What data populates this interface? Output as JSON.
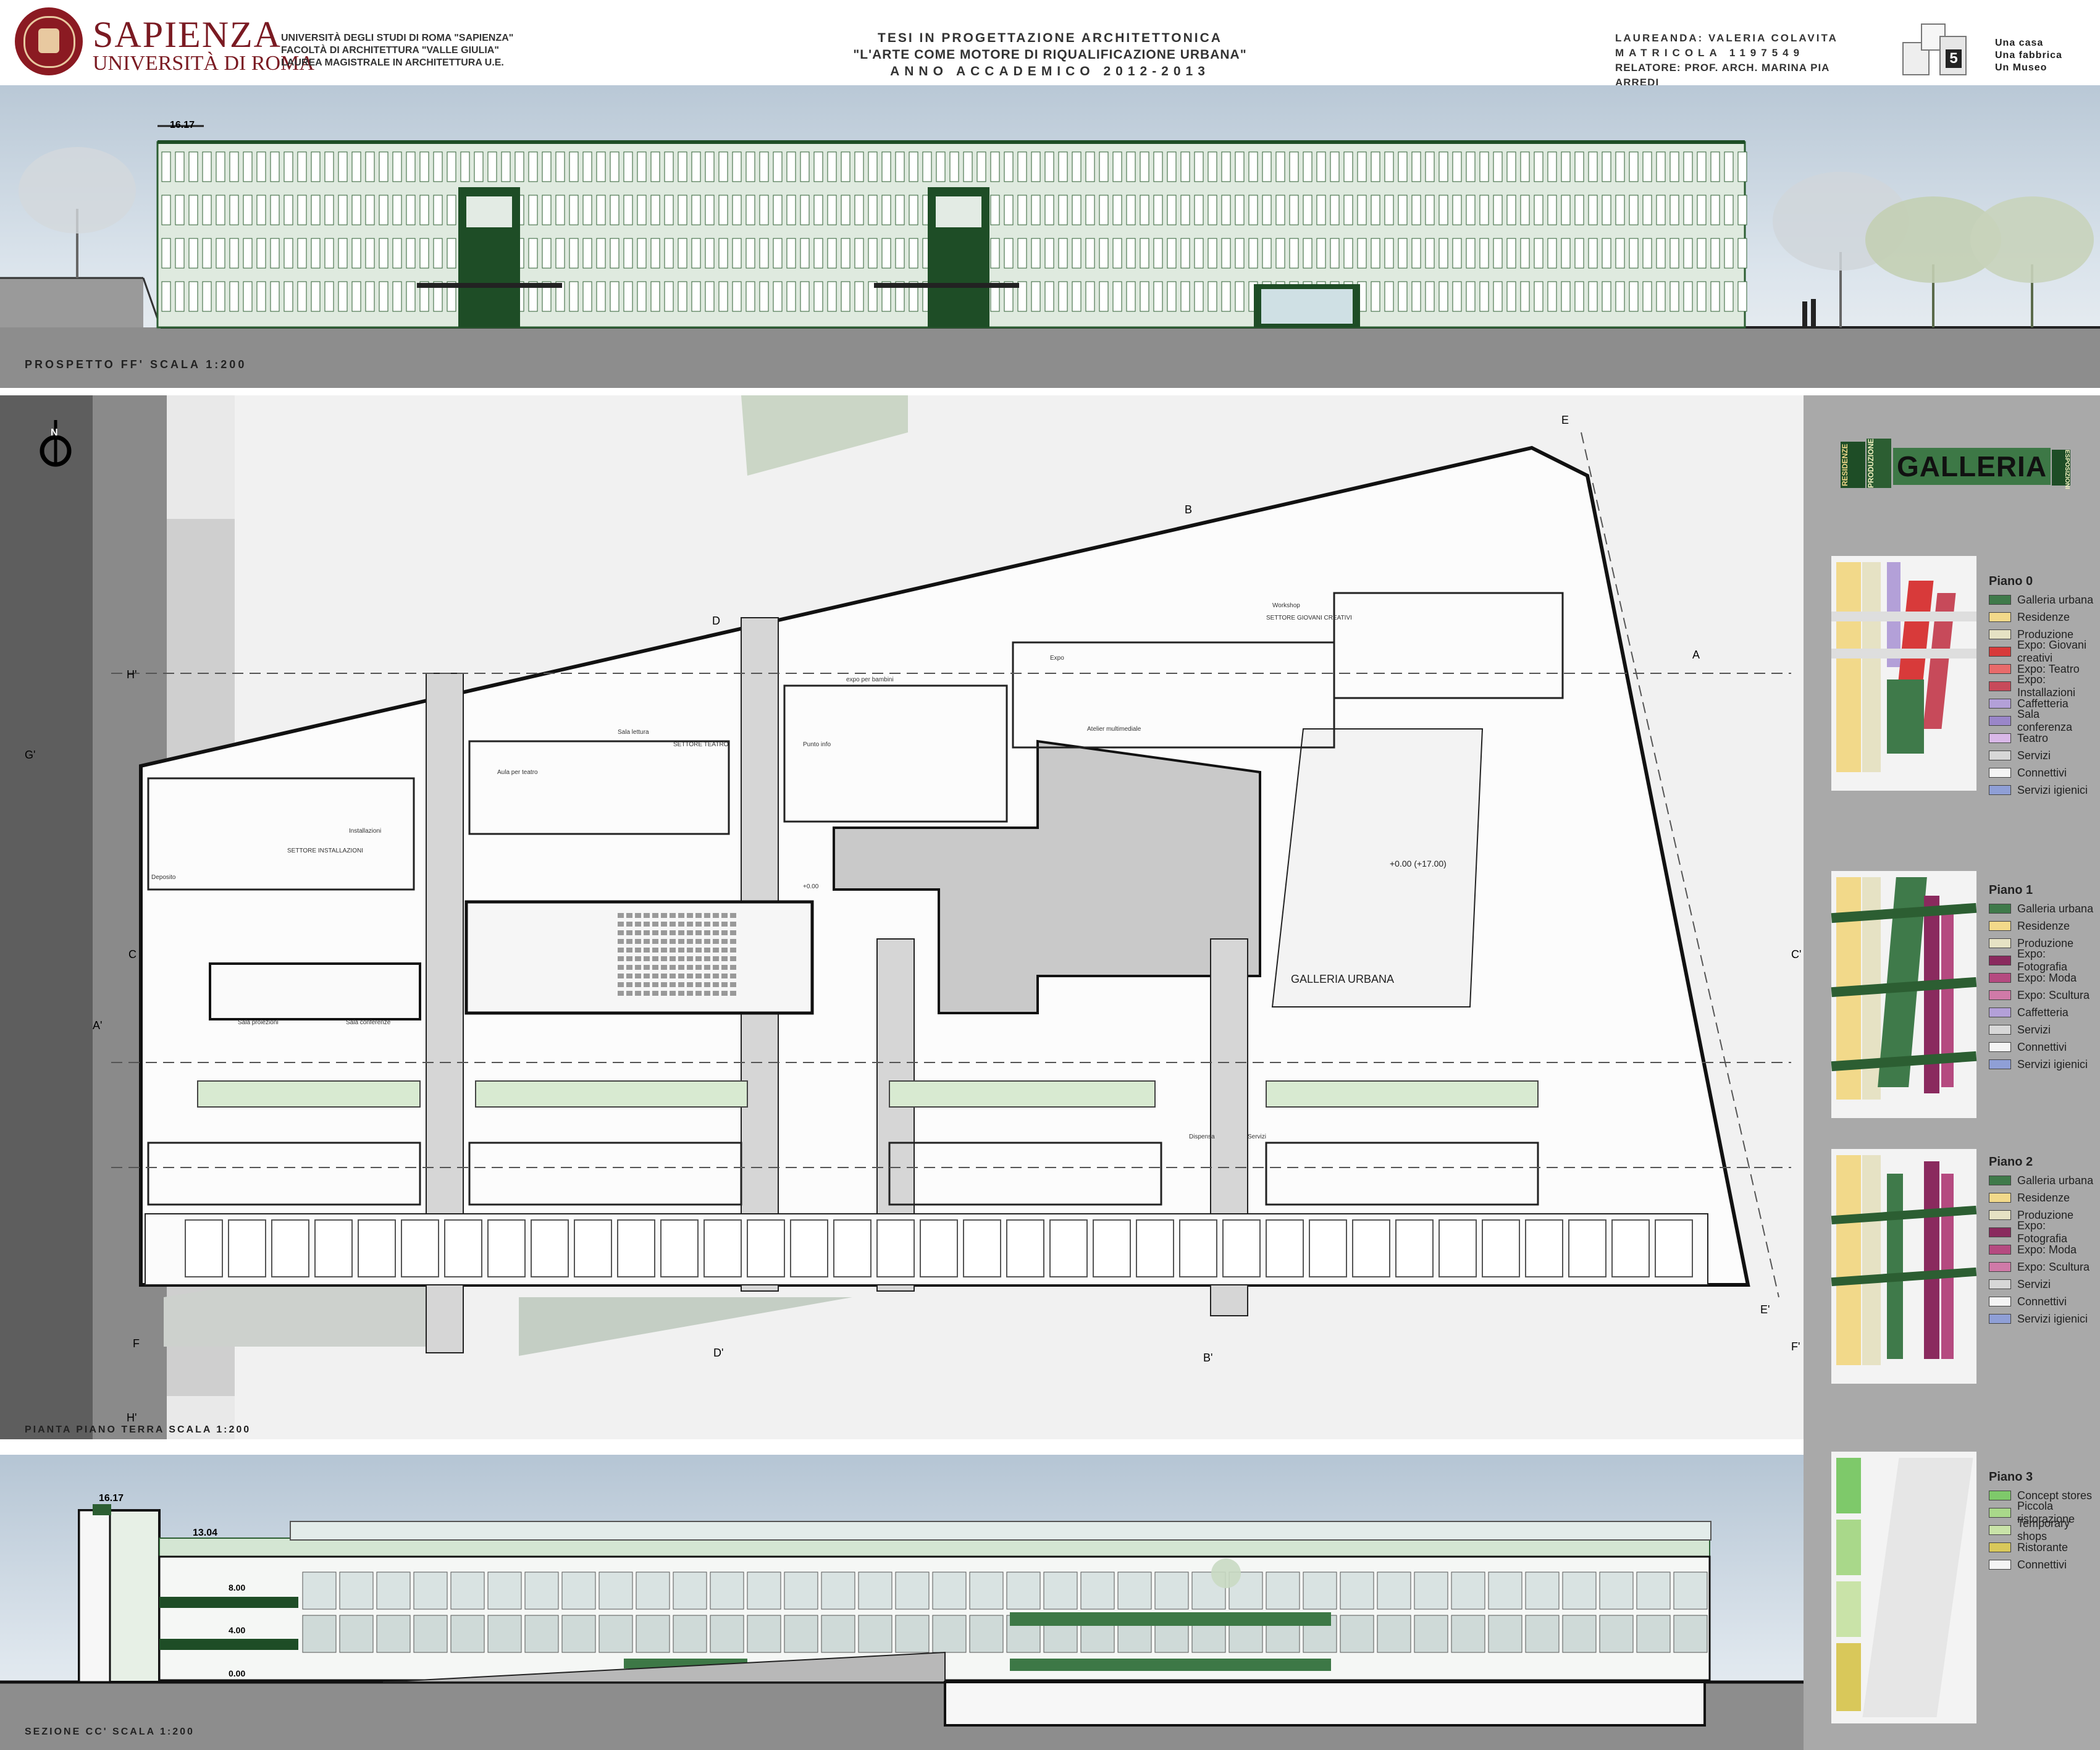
{
  "header": {
    "university_name": "SAPIENZA",
    "university_sub": "UNIVERSITÀ DI ROMA",
    "info_lines": [
      "UNIVERSITÀ DEGLI STUDI DI ROMA \"SAPIENZA\"",
      "FACOLTÀ DI ARCHITETTURA \"VALLE GIULIA\"",
      "LAUREA MAGISTRALE IN ARCHITETTURA U.E."
    ],
    "thesis_lines": [
      "TESI IN PROGETTAZIONE ARCHITETTONICA",
      "\"L'ARTE COME MOTORE DI RIQUALIFICAZIONE URBANA\"",
      "ANNO ACCADEMICO 2012-2013"
    ],
    "author_lines": [
      "LAUREANDA: VALERIA COLAVITA",
      "MATRICOLA 1197549",
      "RELATORE: PROF. ARCH. MARINA PIA ARREDI"
    ],
    "logo_number": "5",
    "tagline": [
      "Una casa",
      "Una fabbrica",
      "Un Museo"
    ]
  },
  "elevation": {
    "level": "16.17",
    "label": "PROSPETTO FF' SCALA 1:200"
  },
  "plan": {
    "label": "PIANTA PIANO TERRA SCALA 1:200",
    "north": "N",
    "area_label": "GALLERIA URBANA",
    "level_label": "+0.00 (+17.00)",
    "section_marks": [
      "A",
      "A'",
      "B",
      "B'",
      "C",
      "C'",
      "D",
      "D'",
      "E",
      "E'",
      "F",
      "F'",
      "G'",
      "H'",
      "H'"
    ],
    "room_labels": [
      "SETTORE INSTALLAZIONI",
      "SETTORE TEATRO",
      "SETTORE GIOVANI CREATIVI",
      "Deposito",
      "Installazioni",
      "Aula per teatro",
      "Sala lettura",
      "Punto info",
      "expo per bambini",
      "Expo",
      "Atelier multimediale",
      "Workshop",
      "Sala proiezioni",
      "Sala conferenze",
      "Dispensa",
      "Servizi",
      "+0.00"
    ]
  },
  "section": {
    "levels": [
      "16.17",
      "13.04",
      "8.00",
      "4.00",
      "0.00"
    ],
    "label": "SEZIONE CC' SCALA 1:200"
  },
  "sidebar": {
    "banner_words": [
      "RESIDENZE",
      "PRODUZIONE",
      "GALLERIA",
      "ESPOSIZIONI"
    ],
    "legends": [
      {
        "title": "Piano 0",
        "items": [
          {
            "label": "Galleria urbana",
            "color": "#3f7a4a"
          },
          {
            "label": "Residenze",
            "color": "#f2d98a"
          },
          {
            "label": "Produzione",
            "color": "#e6e2c4"
          },
          {
            "label": "Expo: Giovani creativi",
            "color": "#d83a3a"
          },
          {
            "label": "Expo: Teatro",
            "color": "#e86b6b"
          },
          {
            "label": "Expo: Installazioni",
            "color": "#c74a5a"
          },
          {
            "label": "Caffetteria",
            "color": "#b3a0d8"
          },
          {
            "label": "Sala conferenza",
            "color": "#9a86c9"
          },
          {
            "label": "Teatro",
            "color": "#d9b8e8"
          },
          {
            "label": "Servizi",
            "color": "#d7d7d7"
          },
          {
            "label": "Connettivi",
            "color": "#f4f4f4"
          },
          {
            "label": "Servizi igienici",
            "color": "#8f9fd6"
          }
        ]
      },
      {
        "title": "Piano 1",
        "items": [
          {
            "label": "Galleria urbana",
            "color": "#3f7a4a"
          },
          {
            "label": "Residenze",
            "color": "#f2d98a"
          },
          {
            "label": "Produzione",
            "color": "#e6e2c4"
          },
          {
            "label": "Expo: Fotografia",
            "color": "#8a2a5e"
          },
          {
            "label": "Expo: Moda",
            "color": "#b54a80"
          },
          {
            "label": "Expo: Scultura",
            "color": "#d07aa8"
          },
          {
            "label": "Caffetteria",
            "color": "#b3a0d8"
          },
          {
            "label": "Servizi",
            "color": "#d7d7d7"
          },
          {
            "label": "Connettivi",
            "color": "#f4f4f4"
          },
          {
            "label": "Servizi igienici",
            "color": "#8f9fd6"
          }
        ]
      },
      {
        "title": "Piano 2",
        "items": [
          {
            "label": "Galleria urbana",
            "color": "#3f7a4a"
          },
          {
            "label": "Residenze",
            "color": "#f2d98a"
          },
          {
            "label": "Produzione",
            "color": "#e6e2c4"
          },
          {
            "label": "Expo: Fotografia",
            "color": "#8a2a5e"
          },
          {
            "label": "Expo: Moda",
            "color": "#b54a80"
          },
          {
            "label": "Expo: Scultura",
            "color": "#d07aa8"
          },
          {
            "label": "Servizi",
            "color": "#d7d7d7"
          },
          {
            "label": "Connettivi",
            "color": "#f4f4f4"
          },
          {
            "label": "Servizi igienici",
            "color": "#8f9fd6"
          }
        ]
      },
      {
        "title": "Piano 3",
        "items": [
          {
            "label": "Concept stores",
            "color": "#7ec96a"
          },
          {
            "label": "Piccola ristorazione",
            "color": "#a9d88a"
          },
          {
            "label": "Temporary shops",
            "color": "#c9e3a8"
          },
          {
            "label": "Ristorante",
            "color": "#d9c85a"
          },
          {
            "label": "Connettivi",
            "color": "#f4f4f4"
          }
        ]
      }
    ]
  }
}
